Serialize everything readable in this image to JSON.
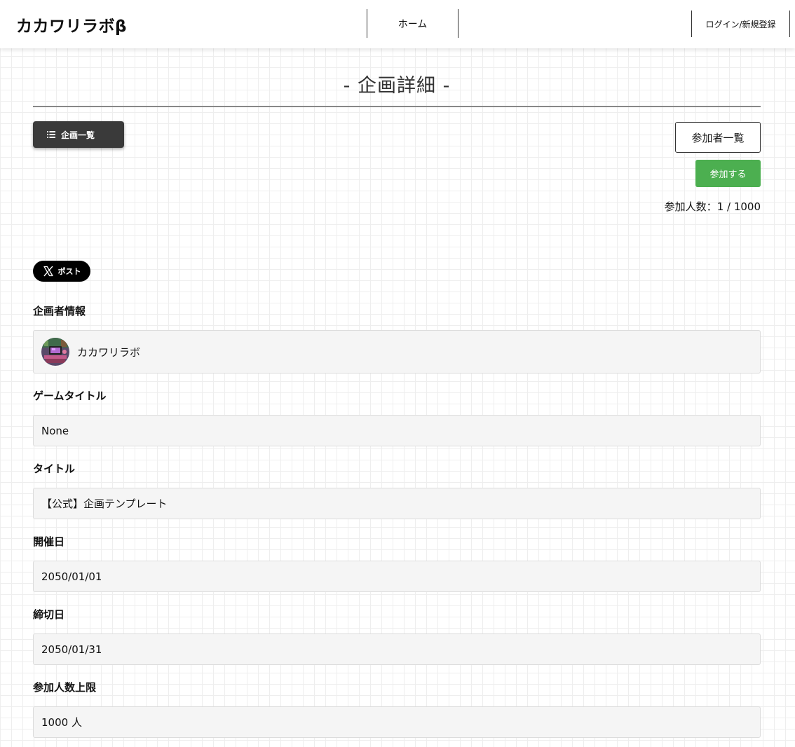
{
  "header": {
    "logo": "カカワリラボβ",
    "nav_home": "ホーム",
    "nav_login": "ログイン/新規登録"
  },
  "page": {
    "title": "- 企画詳細 -"
  },
  "actions": {
    "list_button": "企画一覧",
    "list_icon": "list-icon",
    "participants_button": "参加者一覧",
    "join_button": "参加する",
    "join_color": "#4caf50",
    "participant_count_label": "参加人数：",
    "participant_count_value": "1 / 1000",
    "post_button": "ポスト",
    "post_icon": "x-logo-icon"
  },
  "fields": {
    "organizer": {
      "label": "企画者情報",
      "name": "カカワリラボ"
    },
    "game_title": {
      "label": "ゲームタイトル",
      "value": "None"
    },
    "title": {
      "label": "タイトル",
      "value": "【公式】企画テンプレート"
    },
    "event_date": {
      "label": "開催日",
      "value": "2050/01/01"
    },
    "deadline": {
      "label": "締切日",
      "value": "2050/01/31"
    },
    "capacity": {
      "label": "参加人数上限",
      "value": "1000 人"
    }
  }
}
